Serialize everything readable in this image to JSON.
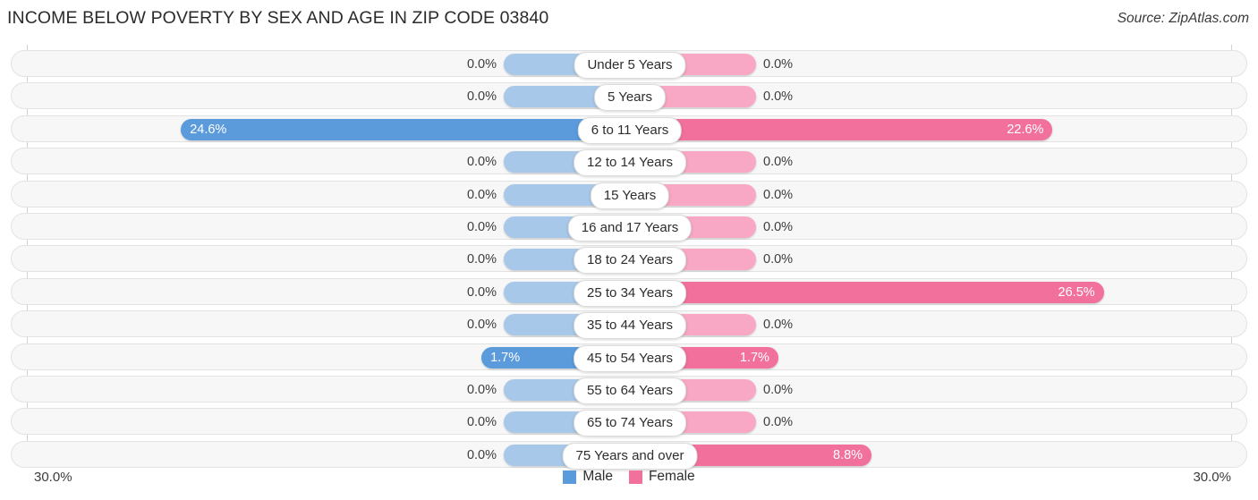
{
  "header": {
    "title": "INCOME BELOW POVERTY BY SEX AND AGE IN ZIP CODE 03840",
    "source": "Source: ZipAtlas.com"
  },
  "axis": {
    "left_tick": "30.0%",
    "right_tick": "30.0%",
    "max_percent": 30.0
  },
  "legend": {
    "items": [
      {
        "label": "Male",
        "color": "#5b9bdc",
        "swatch_name": "legend-swatch-male"
      },
      {
        "label": "Female",
        "color": "#f2709c",
        "swatch_name": "legend-swatch-female"
      }
    ]
  },
  "chart_data": {
    "type": "bar",
    "title": "INCOME BELOW POVERTY BY SEX AND AGE IN ZIP CODE 03840",
    "subtitle": "Source: ZipAtlas.com",
    "orientation": "horizontal-diverging",
    "xlabel": "",
    "ylabel": "",
    "xlim": [
      30.0,
      30.0
    ],
    "grid": false,
    "legend_position": "bottom-center",
    "categories": [
      "Under 5 Years",
      "5 Years",
      "6 to 11 Years",
      "12 to 14 Years",
      "15 Years",
      "16 and 17 Years",
      "18 to 24 Years",
      "25 to 34 Years",
      "35 to 44 Years",
      "45 to 54 Years",
      "55 to 64 Years",
      "65 to 74 Years",
      "75 Years and over"
    ],
    "series": [
      {
        "name": "Male",
        "color": "#5b9bdc",
        "values": [
          0.0,
          0.0,
          24.6,
          0.0,
          0.0,
          0.0,
          0.0,
          0.0,
          0.0,
          1.7,
          0.0,
          0.0,
          0.0
        ],
        "labels": [
          "0.0%",
          "0.0%",
          "24.6%",
          "0.0%",
          "0.0%",
          "0.0%",
          "0.0%",
          "0.0%",
          "0.0%",
          "1.7%",
          "0.0%",
          "0.0%",
          "0.0%"
        ]
      },
      {
        "name": "Female",
        "color": "#f2709c",
        "values": [
          0.0,
          0.0,
          22.6,
          0.0,
          0.0,
          0.0,
          0.0,
          26.5,
          0.0,
          1.7,
          0.0,
          0.0,
          8.8
        ],
        "labels": [
          "0.0%",
          "0.0%",
          "22.6%",
          "0.0%",
          "0.0%",
          "0.0%",
          "0.0%",
          "26.5%",
          "0.0%",
          "1.7%",
          "0.0%",
          "0.0%",
          "8.8%"
        ]
      }
    ]
  }
}
